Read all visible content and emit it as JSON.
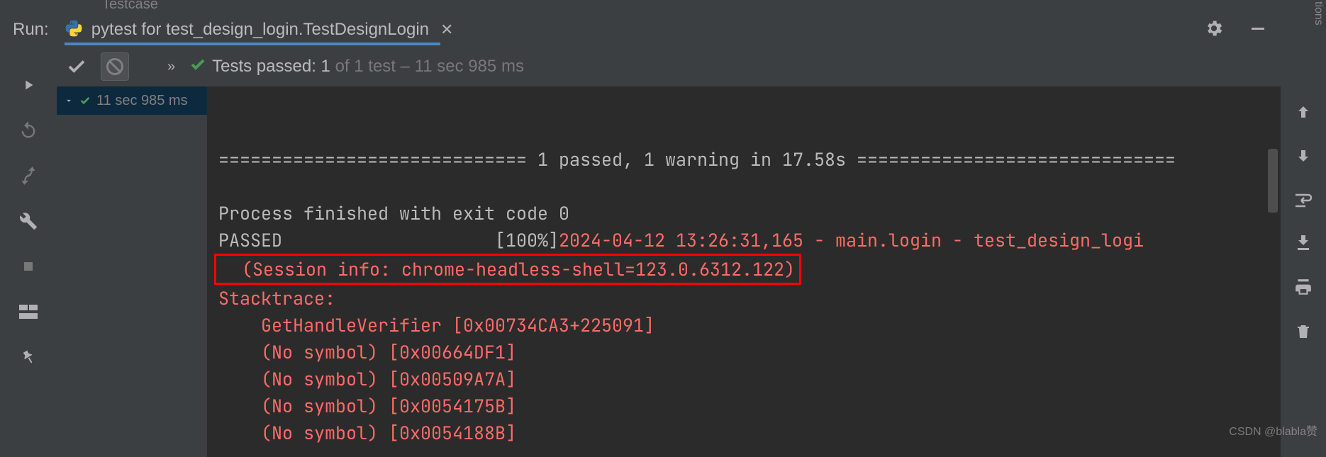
{
  "partial_top": "Testcase",
  "run_label": "Run:",
  "tab": {
    "title": "pytest for test_design_login.TestDesignLogin"
  },
  "toolbar": {
    "chevrons": "»",
    "tests_passed_prefix": "Tests passed: ",
    "tests_passed_count": "1",
    "tests_passed_suffix": " of 1 test – 11 sec 985 ms"
  },
  "tree": {
    "duration": "11 sec 985 ms"
  },
  "console": {
    "separator_line": "============================= 1 passed, 1 warning in 17.58s ==============================",
    "blank": "",
    "process_finished": "Process finished with exit code 0",
    "passed_label": "PASSED",
    "passed_pad": "                    ",
    "percent": "[100%]",
    "timestamp_line": "2024-04-12 13:26:31,165 - main.login - test_design_logi",
    "session_info": "  (Session info: chrome-headless-shell=123.0.6312.122)",
    "stacktrace_label": "Stacktrace:",
    "trace1": "    GetHandleVerifier [0x00734CA3+225091]",
    "trace2": "    (No symbol) [0x00664DF1]",
    "trace3": "    (No symbol) [0x00509A7A]",
    "trace4": "    (No symbol) [0x0054175B]",
    "trace5": "    (No symbol) [0x0054188B]"
  },
  "side_text": "tions",
  "watermark": "CSDN @blabla赞"
}
